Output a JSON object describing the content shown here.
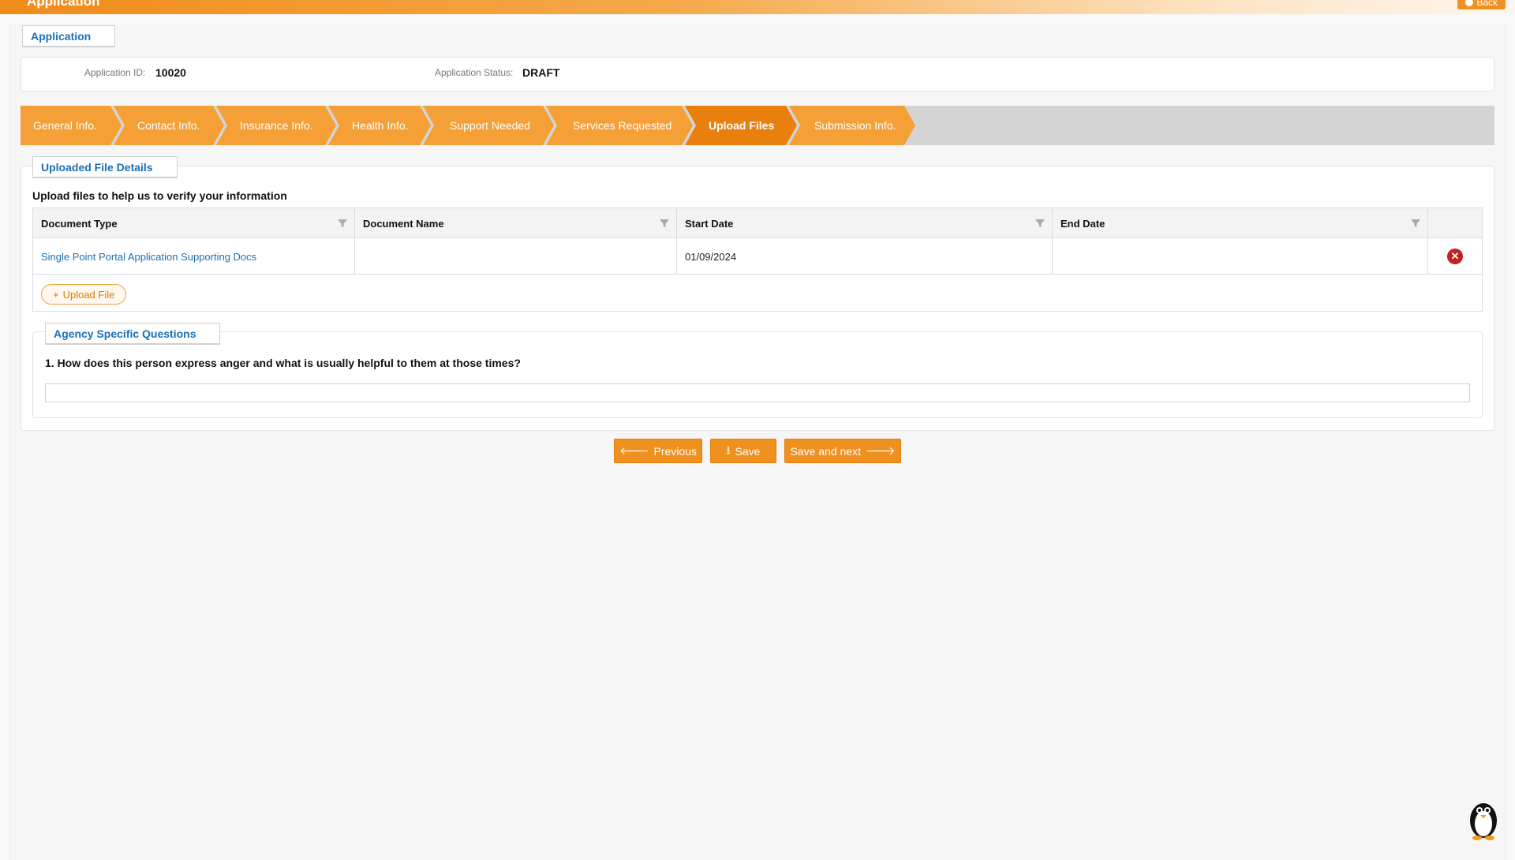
{
  "header": {
    "title": "Application",
    "back_label": "Back"
  },
  "section_tab": "Application",
  "info": {
    "app_id_label": "Application ID:",
    "app_id_value": "10020",
    "status_label": "Application Status:",
    "status_value": "DRAFT"
  },
  "steps": [
    {
      "label": "General Info."
    },
    {
      "label": "Contact Info."
    },
    {
      "label": "Insurance Info."
    },
    {
      "label": "Health Info."
    },
    {
      "label": "Support Needed"
    },
    {
      "label": "Services Requested"
    },
    {
      "label": "Upload Files",
      "active": true
    },
    {
      "label": "Submission Info."
    }
  ],
  "upload": {
    "section_title": "Uploaded File Details",
    "intro": "Upload files to help us to verify your information",
    "columns": [
      "Document Type",
      "Document Name",
      "Start Date",
      "End Date"
    ],
    "rows": [
      {
        "document_type": "Single Point Portal Application Supporting Docs",
        "document_name": "",
        "start_date": "01/09/2024",
        "end_date": ""
      }
    ],
    "upload_button": "Upload File"
  },
  "agency": {
    "section_title": "Agency Specific Questions",
    "question": "1. How does this person express anger and what is usually helpful to them at those times?",
    "answer": ""
  },
  "actions": {
    "previous": "Previous",
    "save": "Save",
    "save_next": "Save and next"
  },
  "colors": {
    "accent": "#f5a037",
    "accent_active": "#e9800d",
    "link": "#1a6fb5",
    "delete": "#c62020"
  }
}
